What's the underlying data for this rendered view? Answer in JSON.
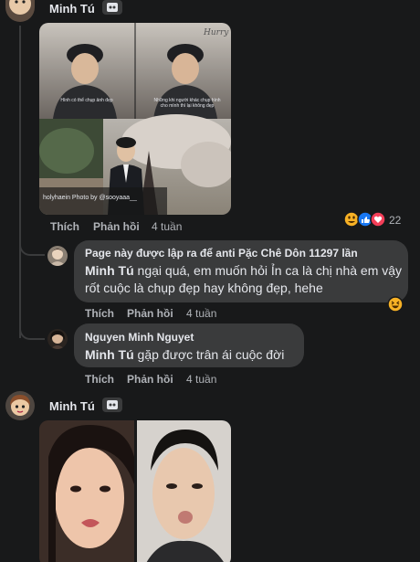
{
  "comment1": {
    "author": "Minh Tú",
    "image_caption_left": "Hình có thể chụp ảnh đẹp",
    "image_caption_right": "Những khi người khác chụp hình cho mình thì lại không đẹp",
    "image_watermark": "holyhaein Photo by @sooyaaa__",
    "image_signature": "Hurry",
    "actions": {
      "like": "Thích",
      "reply": "Phản hồi",
      "time": "4 tuần"
    },
    "reaction_count": "22"
  },
  "reply1": {
    "author": "Page này được lập ra để anti Pặc Chê Dôn 11297 lần",
    "mention": "Minh Tú",
    "text": " ngại quá, em muốn hỏi Ỉn ca là chị nhà em vậy rốt cuộc là chụp đẹp hay không đẹp, hehe",
    "actions": {
      "like": "Thích",
      "reply": "Phản hồi",
      "time": "4 tuần"
    }
  },
  "reply2": {
    "author": "Nguyen Minh Nguyet",
    "mention": "Minh Tú",
    "text": " gặp được trân ái cuộc đời",
    "actions": {
      "like": "Thích",
      "reply": "Phản hồi",
      "time": "4 tuần"
    }
  },
  "comment2": {
    "author": "Minh Tú"
  },
  "colors": {
    "background": "#18191a",
    "bubble": "#3a3b3c",
    "text": "#e4e6eb",
    "secondary": "#b0b3b8"
  }
}
